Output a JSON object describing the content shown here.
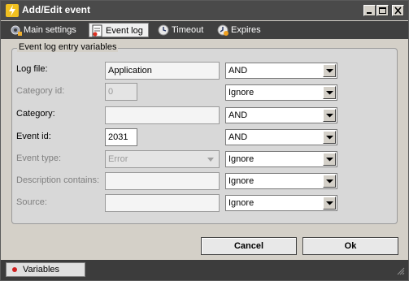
{
  "window": {
    "title": "Add/Edit event"
  },
  "tabs": [
    {
      "label": "Main settings",
      "icon": "gear-icon"
    },
    {
      "label": "Event log",
      "icon": "event-log-icon"
    },
    {
      "label": "Timeout",
      "icon": "clock-icon"
    },
    {
      "label": "Expires",
      "icon": "expires-icon"
    }
  ],
  "active_tab": "Event log",
  "group": {
    "title": "Event log entry variables"
  },
  "rows": {
    "log_file": {
      "label": "Log file:",
      "value": "Application",
      "operator": "AND"
    },
    "category_id": {
      "label": "Category id:",
      "value": "0",
      "operator": "Ignore"
    },
    "category": {
      "label": "Category:",
      "value": "",
      "operator": "AND"
    },
    "event_id": {
      "label": "Event id:",
      "value": "2031",
      "operator": "AND"
    },
    "event_type": {
      "label": "Event type:",
      "value": "Error",
      "operator": "Ignore"
    },
    "description": {
      "label": "Description contains:",
      "value": "",
      "operator": "Ignore"
    },
    "source": {
      "label": "Source:",
      "value": "",
      "operator": "Ignore"
    }
  },
  "buttons": {
    "cancel": "Cancel",
    "ok": "Ok"
  },
  "statusbar": {
    "variables_label": "Variables"
  },
  "colors": {
    "titlebar": "#4a4a4a",
    "tabbar": "#404040",
    "dialog_bg": "#d4d0c8"
  }
}
